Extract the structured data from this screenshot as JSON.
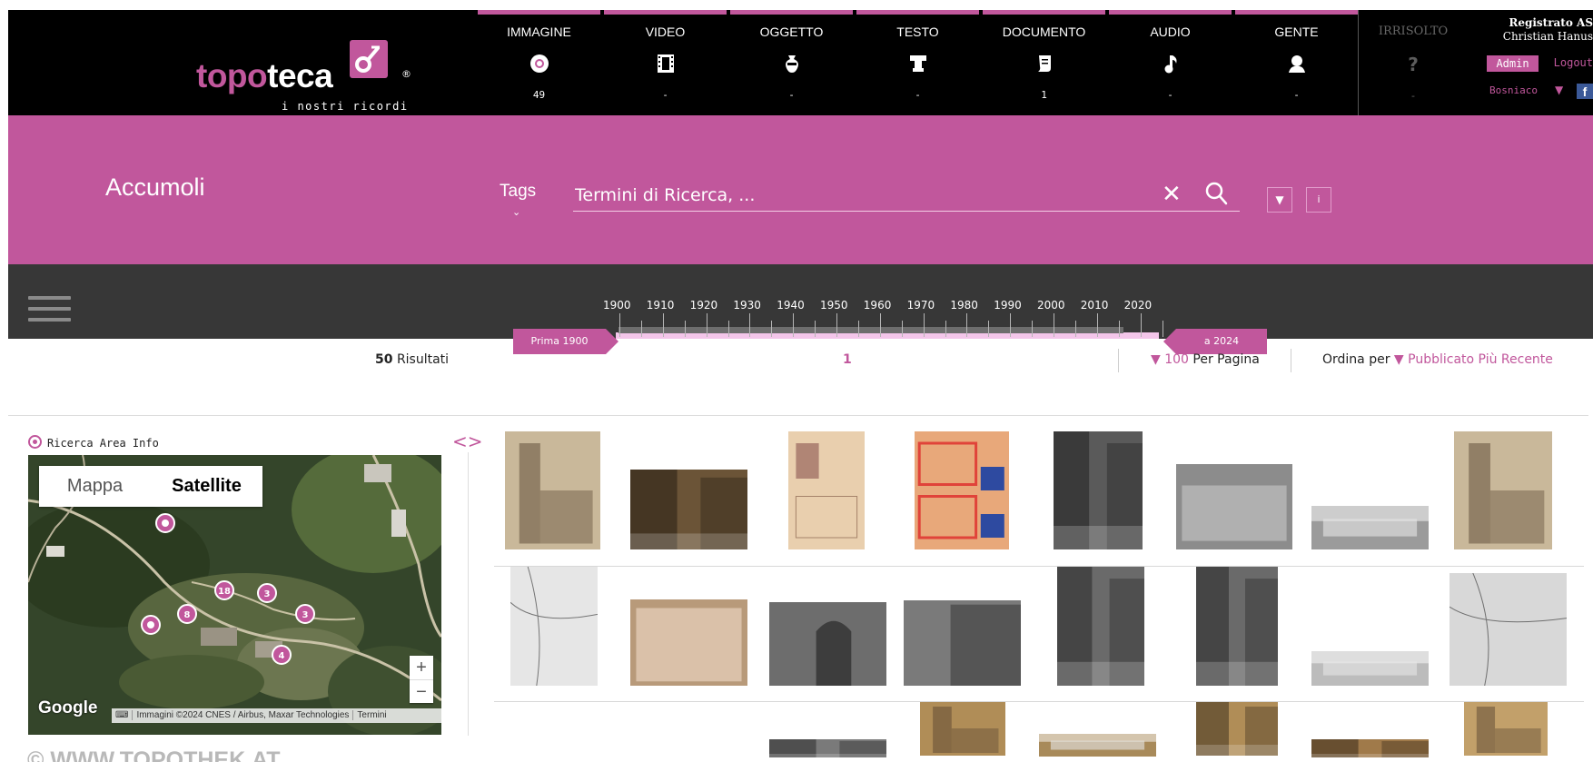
{
  "logo": {
    "word_pink": "topo",
    "word_white": "teca",
    "tagline": "i nostri ricordi",
    "reg": "®"
  },
  "colors": {
    "accent": "#c1579c",
    "header_bg": "#000000",
    "timeline_bg": "#373737"
  },
  "categories": [
    {
      "label": "IMMAGINE",
      "icon": "image-icon",
      "count": "49"
    },
    {
      "label": "VIDEO",
      "icon": "film-icon",
      "count": "-"
    },
    {
      "label": "OGGETTO",
      "icon": "vase-icon",
      "count": "-"
    },
    {
      "label": "TESTO",
      "icon": "text-icon",
      "count": "-"
    },
    {
      "label": "DOCUMENTO",
      "icon": "scroll-icon",
      "count": "1"
    },
    {
      "label": "AUDIO",
      "icon": "music-note-icon",
      "count": "-"
    },
    {
      "label": "GENTE",
      "icon": "person-icon",
      "count": "-"
    }
  ],
  "irrisolto": {
    "label": "IRRISOLTO",
    "icon": "question-icon",
    "glyph": "?",
    "count": "-"
  },
  "user": {
    "registered": "Registrato AS",
    "name": "Christian Hanus",
    "admin": "Admin",
    "logout": "Logout",
    "region": "Bosniaco",
    "fb": "f"
  },
  "search": {
    "location": "Accumoli",
    "tags_label": "Tags",
    "placeholder": "Termini di Ricerca, ...",
    "clear": "✕",
    "info_button": "i",
    "dropdown_button": "▼"
  },
  "timeline": {
    "years": [
      "1900",
      "1910",
      "1920",
      "1930",
      "1940",
      "1950",
      "1960",
      "1970",
      "1980",
      "1990",
      "2000",
      "2010",
      "2020"
    ],
    "start_label": "Prima 1900",
    "end_label": "a 2024"
  },
  "results": {
    "count": "50",
    "count_label": "Risultati",
    "page": "1",
    "per_page": "100",
    "per_page_label": "Per Pagina",
    "sort_label": "Ordina per",
    "sort_value": "Pubblicato Più Recente",
    "caret": "▼"
  },
  "map": {
    "info_label": "Ricerca Area Info",
    "tab_map": "Mappa",
    "tab_satellite": "Satellite",
    "zoom_in": "+",
    "zoom_out": "−",
    "google": "Google",
    "attribution": "Immagini ©2024 CNES / Airbus, Maxar Technologies",
    "terms": "Termini",
    "clusters": [
      "18",
      "3",
      "8",
      "3",
      "4"
    ],
    "collapse_arrows": "<>"
  },
  "footer": {
    "copyright": "© WWW.TOPOTHEK.AT"
  }
}
